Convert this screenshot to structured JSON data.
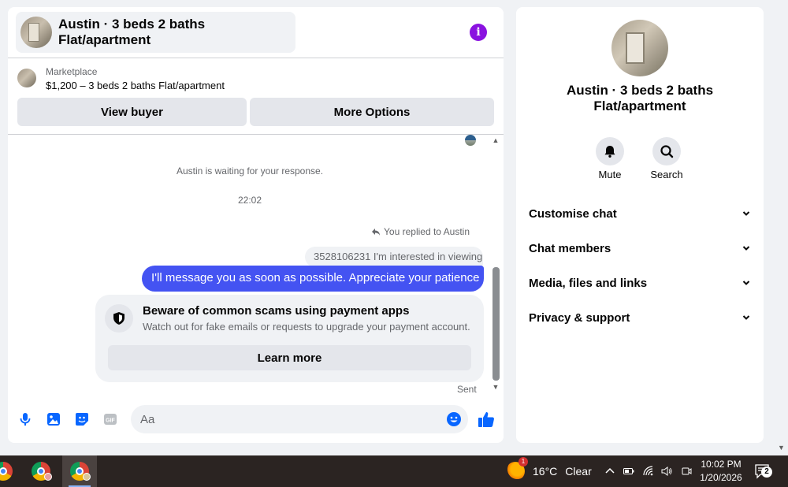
{
  "chat": {
    "title": "Austin · 3 beds 2 baths Flat/apartment",
    "marketplace_label": "Marketplace",
    "listing_price_title": "$1,200 – 3 beds 2 baths Flat/apartment",
    "view_buyer_label": "View buyer",
    "more_options_label": "More Options",
    "waiting_text": "Austin is waiting for your response.",
    "timestamp": "22:02",
    "replied_text": "You replied to Austin",
    "quoted_message": "3528106231 I'm interested in viewing",
    "outgoing_message": "I'll message you as soon as possible. Appreciate your patience",
    "scam_title": "Beware of common scams using payment apps",
    "scam_description": "Watch out for fake emails or requests to upgrade your payment account.",
    "learn_more_label": "Learn more",
    "sent_label": "Sent",
    "input_placeholder": "Aa",
    "accent_color": "#4453f2"
  },
  "info": {
    "name_line1": "Austin · 3 beds 2 baths",
    "name_line2": "Flat/apartment",
    "mute_label": "Mute",
    "search_label": "Search",
    "menu": [
      {
        "label": "Customise chat"
      },
      {
        "label": "Chat members"
      },
      {
        "label": "Media, files and links"
      },
      {
        "label": "Privacy & support"
      }
    ]
  },
  "taskbar": {
    "temperature": "16°C",
    "condition": "Clear",
    "weather_badge": "1",
    "time": "10:02 PM",
    "date": "1/20/2026",
    "notification_count": "2"
  }
}
